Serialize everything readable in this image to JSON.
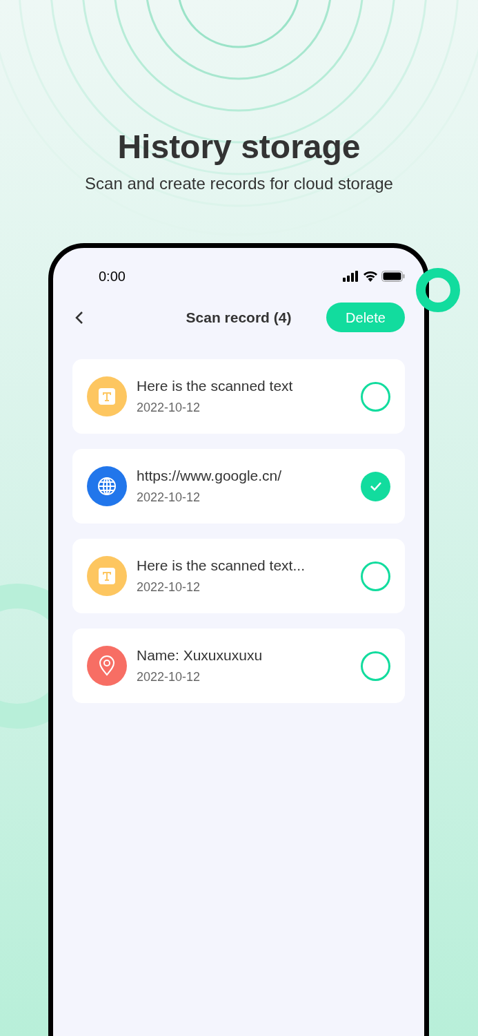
{
  "headline": {
    "title": "History storage",
    "subtitle": "Scan and create records for cloud storage"
  },
  "status_bar": {
    "time": "0:00"
  },
  "nav": {
    "title": "Scan record (4)",
    "action": "Delete"
  },
  "records": [
    {
      "kind": "text",
      "title": "Here is the scanned text",
      "date": "2022-10-12",
      "selected": false
    },
    {
      "kind": "link",
      "title": "https://www.google.cn/",
      "date": "2022-10-12",
      "selected": true
    },
    {
      "kind": "text",
      "title": "Here is the scanned text...",
      "date": "2022-10-12",
      "selected": false
    },
    {
      "kind": "location",
      "title": "Name: Xuxuxuxuxu",
      "date": "2022-10-12",
      "selected": false
    }
  ]
}
